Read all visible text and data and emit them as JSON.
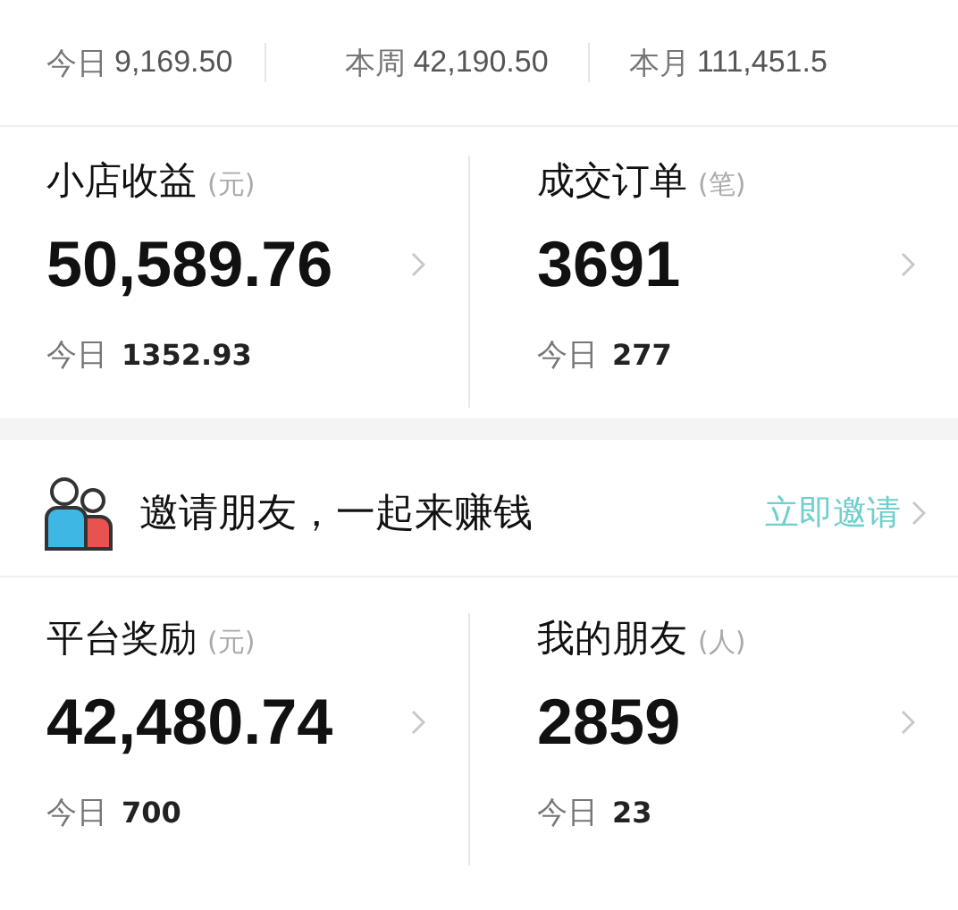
{
  "summary": [
    {
      "label": "今日",
      "value": "9,169.50"
    },
    {
      "label": "本周",
      "value": "42,190.50"
    },
    {
      "label": "本月",
      "value": "111,451.5"
    }
  ],
  "shop_stats": [
    {
      "title": "小店收益",
      "unit": "(元)",
      "value": "50,589.76",
      "today_label": "今日",
      "today_value": "1352.93"
    },
    {
      "title": "成交订单",
      "unit": "(笔)",
      "value": "3691",
      "today_label": "今日",
      "today_value": "277"
    }
  ],
  "invite": {
    "text": "邀请朋友，一起来赚钱",
    "action": "立即邀请"
  },
  "reward_stats": [
    {
      "title": "平台奖励",
      "unit": "(元)",
      "value": "42,480.74",
      "today_label": "今日",
      "today_value": "700"
    },
    {
      "title": "我的朋友",
      "unit": "(人)",
      "value": "2859",
      "today_label": "今日",
      "today_value": "23"
    }
  ]
}
